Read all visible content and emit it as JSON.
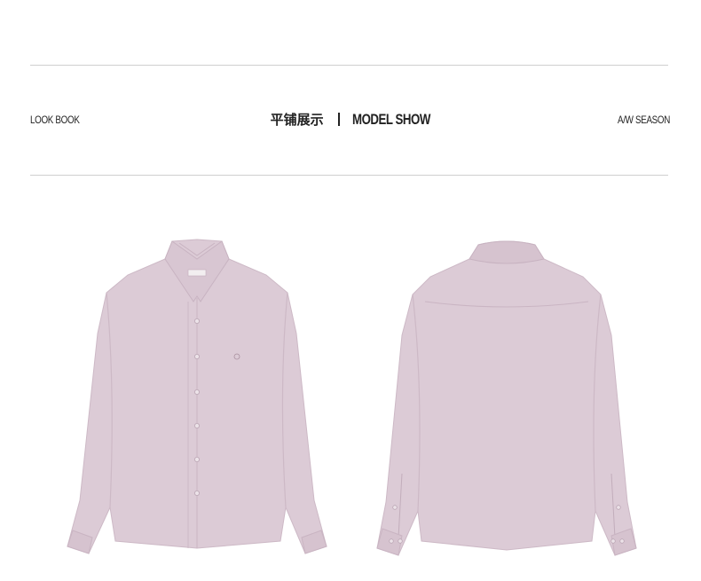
{
  "header": {
    "left_label": "LOOK BOOK",
    "title_zh": "平铺展示",
    "title_en": "MODEL SHOW",
    "right_label": "A/W SEASON"
  },
  "colors": {
    "shirt_fill": "#dccbd6",
    "shirt_shadow": "#cdb9c6",
    "rule": "#cfcfcf",
    "text": "#222222"
  },
  "products": [
    {
      "view": "front"
    },
    {
      "view": "back"
    }
  ]
}
